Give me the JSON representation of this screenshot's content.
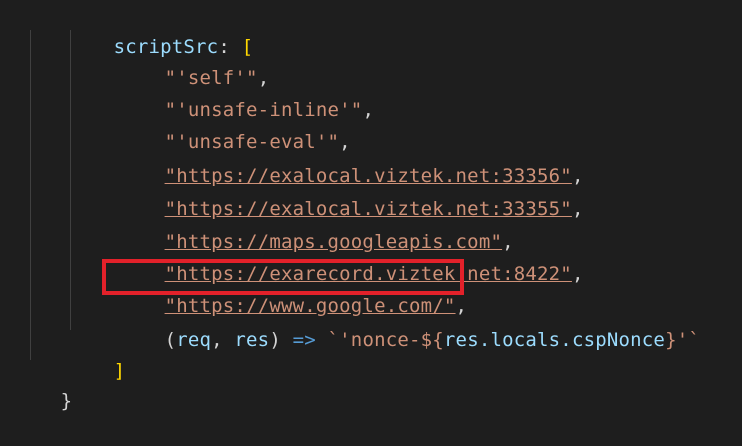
{
  "code": {
    "l1_key": "scriptSrc",
    "l1_colon": ": ",
    "l1_open": "[",
    "l2_str": "\"'self'\"",
    "l3_str": "\"'unsafe-inline'\"",
    "l4_str": "\"'unsafe-eval'\"",
    "l5_url": "\"https://exalocal.viztek.net:33356\"",
    "l6_url": "\"https://exalocal.viztek.net:33355\"",
    "l7_url": "\"https://maps.googleapis.com\"",
    "l8_url": "\"https://exarecord.viztek.net:8422\"",
    "l9_url": "\"https://www.google.com/\"",
    "comma": ",",
    "l10_open_paren": "(",
    "l10_req": "req",
    "l10_sep": ", ",
    "l10_res": "res",
    "l10_close_paren": ") ",
    "l10_arrow": "=>",
    "l10_tmpl_start": " `'nonce-${",
    "l10_expr": "res.locals.cspNonce",
    "l10_tmpl_end": "}'`",
    "l11_close": "]",
    "l12_close": "}"
  },
  "colors": {
    "background": "#1e1e1e",
    "string": "#ce9178",
    "property": "#9cdcfe",
    "keyword": "#569cd6",
    "highlight_border": "#e3212a"
  }
}
